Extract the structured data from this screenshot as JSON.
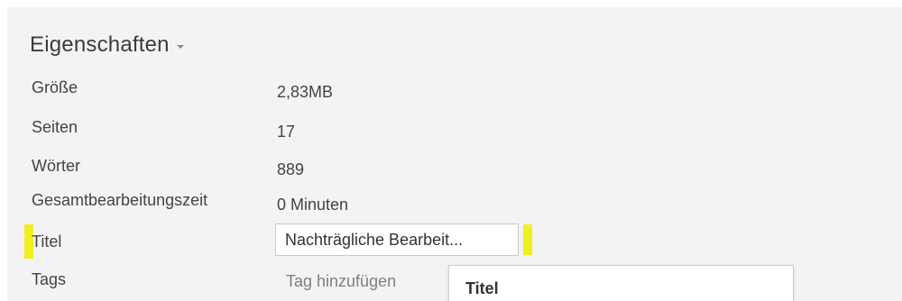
{
  "section": {
    "title": "Eigenschaften"
  },
  "properties": {
    "groesse": {
      "label": "Größe",
      "value": "2,83MB"
    },
    "seiten": {
      "label": "Seiten",
      "value": "17"
    },
    "woerter": {
      "label": "Wörter",
      "value": "889"
    },
    "gesamtbearbeitungszeit": {
      "label": "Gesamtbearbeitungszeit",
      "value": "0 Minuten"
    },
    "titel": {
      "label": "Titel",
      "value": "Nachträgliche Bearbeit..."
    },
    "tags": {
      "label": "Tags",
      "placeholder": "Tag hinzufügen"
    }
  },
  "tooltip": {
    "title": "Titel"
  },
  "colors": {
    "panel_background": "#f3f3f3",
    "highlight": "#f2ef1f",
    "text": "#444444",
    "muted_text": "#7f7f7f"
  }
}
